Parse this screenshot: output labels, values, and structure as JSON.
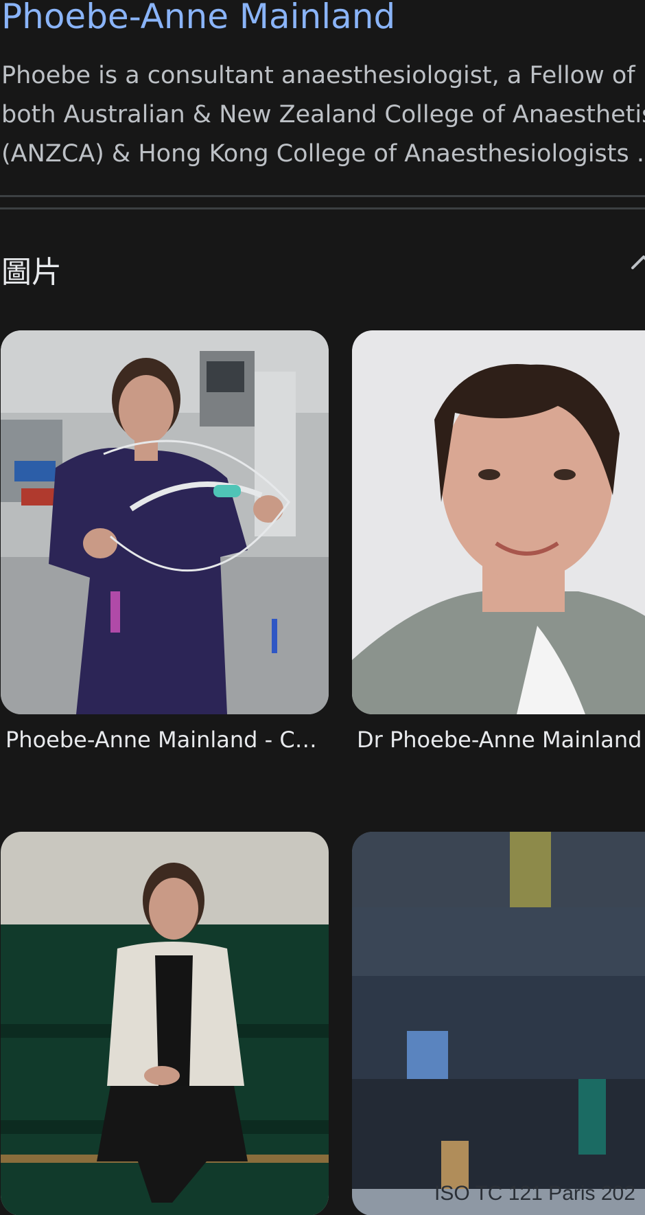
{
  "result": {
    "title": "Phoebe-Anne Mainland",
    "snippet_lines": [
      "Phoebe is a consultant anaesthesiologist, a Fellow of",
      "both Australian & New Zealand College of Anaesthetis",
      "(ANZCA) & Hong Kong College of Anaesthesiologists ."
    ]
  },
  "images_section": {
    "title": "圖片",
    "collapse_icon": "chevron-up-icon",
    "cards": [
      {
        "caption": "Phoebe-Anne Mainland - Chu…",
        "image": "woman-in-scrubs-holding-medical-tubing"
      },
      {
        "caption": "Dr Phoebe-Anne Mainland n",
        "image": "woman-portrait-grey-jacket"
      },
      {
        "caption": "",
        "image": "woman-seated-on-green-bench"
      },
      {
        "caption": "",
        "image": "group-photo-iso-tc-121",
        "overlay_text": "ISO TC 121 Paris 202"
      }
    ]
  },
  "colors": {
    "background": "#171717",
    "title_link": "#8ab4f8",
    "snippet_text": "#bdc1c6",
    "caption_text": "#e8eaed",
    "divider": "#3c4043"
  }
}
